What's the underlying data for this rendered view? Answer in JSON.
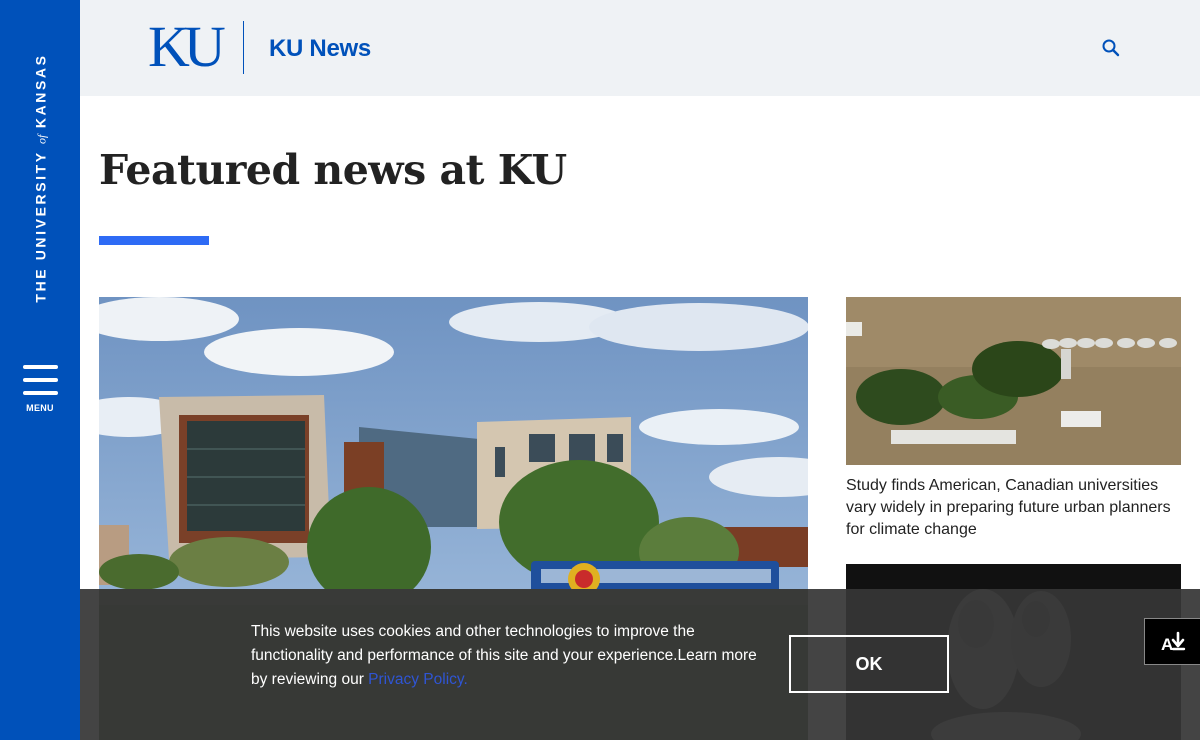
{
  "rail": {
    "wordmark_pre": "THE UNIVERSITY",
    "wordmark_of": "of",
    "wordmark_post": "KANSAS",
    "menu_label": "MENU",
    "menu_icon": "hamburger-icon",
    "color": "#0051ba"
  },
  "header": {
    "logo": "KU",
    "site_name": "KU News",
    "search_icon": "search-icon"
  },
  "main": {
    "title": "Featured news at KU",
    "rule_color": "#2e6bf5",
    "side_articles": [
      {
        "headline": "Study finds American, Canadian universities vary widely in preparing future urban planners for climate change"
      }
    ]
  },
  "cookie": {
    "text": "This website uses cookies and other technologies to improve the functionality and performance of this site and your experience.Learn more by reviewing our ",
    "link_text": "Privacy Policy.",
    "ok_label": "OK"
  },
  "accessibility": {
    "icon": "accessibility-icon"
  }
}
